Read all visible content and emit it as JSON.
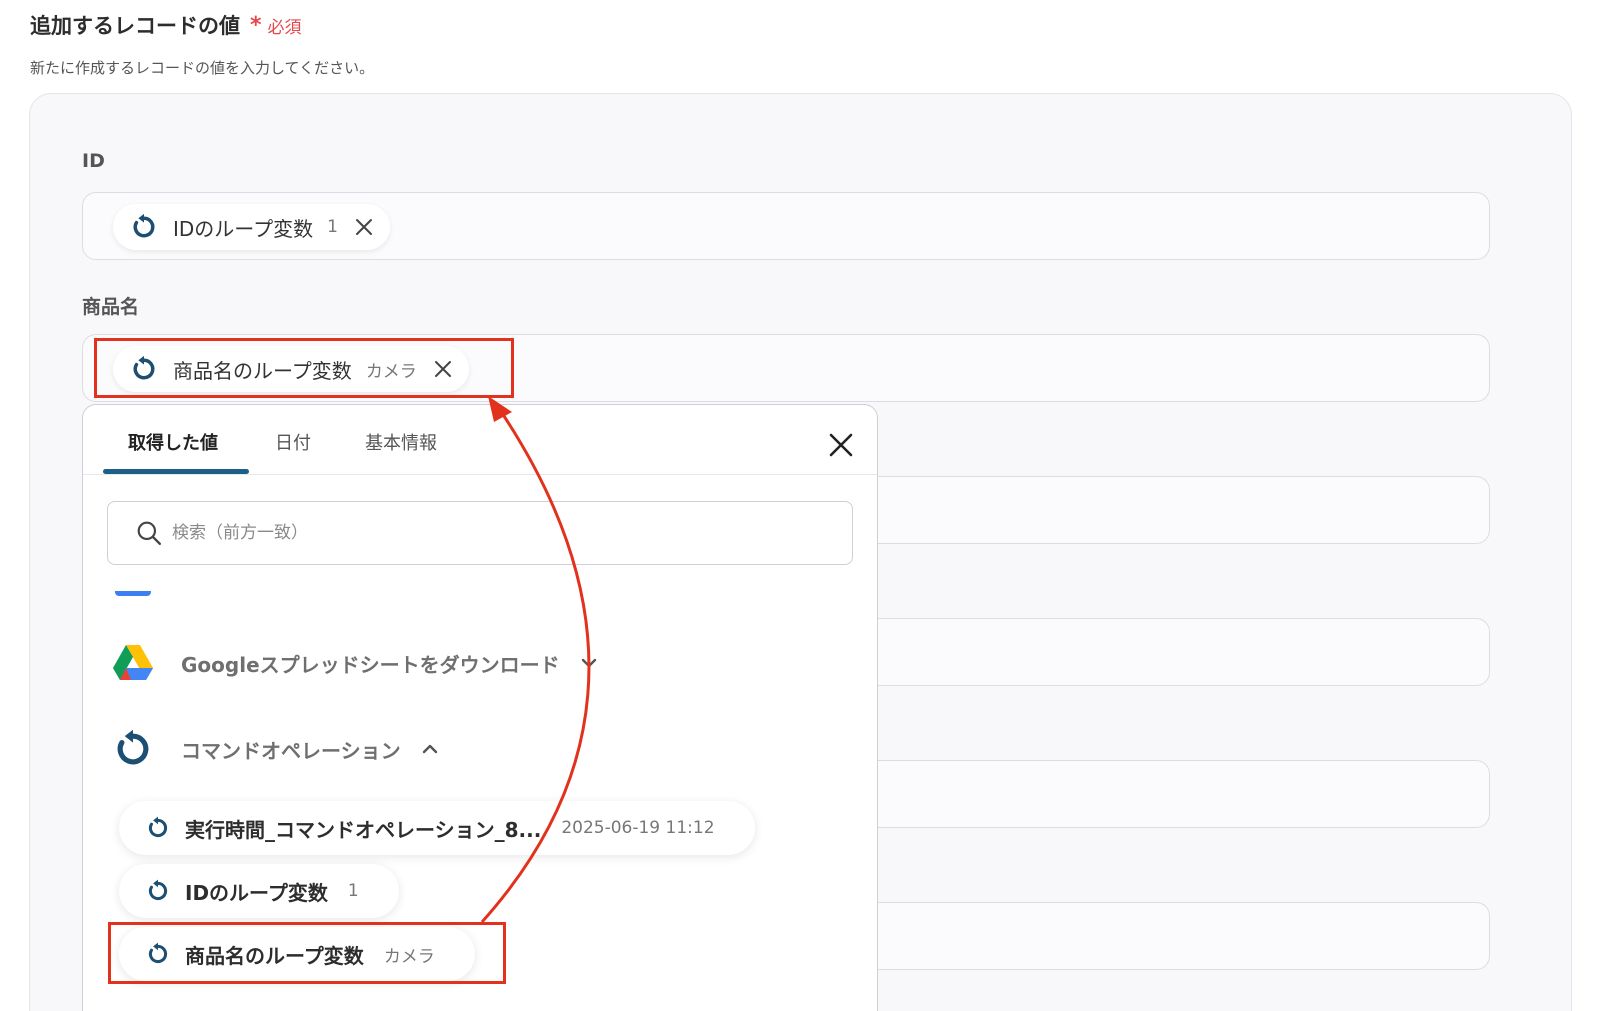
{
  "section": {
    "title": "追加するレコードの値",
    "required_mark": "*",
    "required_text": "必須",
    "description": "新たに作成するレコードの値を入力してください。"
  },
  "fields": [
    {
      "label": "ID",
      "chip": {
        "label": "IDのループ変数",
        "value": "1"
      }
    },
    {
      "label": "商品名",
      "chip": {
        "label": "商品名のループ変数",
        "value": "カメラ"
      }
    }
  ],
  "popup": {
    "tabs": [
      {
        "label": "取得した値",
        "active": true
      },
      {
        "label": "日付",
        "active": false
      },
      {
        "label": "基本情報",
        "active": false
      }
    ],
    "search_placeholder": "検索（前方一致）",
    "groups": [
      {
        "label": "Googleスプレッドシートをダウンロード",
        "icon": "google-drive-icon",
        "expanded": false
      },
      {
        "label": "コマンドオペレーション",
        "icon": "loop-icon",
        "expanded": true
      }
    ],
    "items": [
      {
        "label": "実行時間_コマンドオペレーション_8...",
        "value": "2025-06-19 11:12"
      },
      {
        "label": "IDのループ変数",
        "value": "1"
      },
      {
        "label": "商品名のループ変数",
        "value": "カメラ"
      }
    ]
  },
  "colors": {
    "accent": "#1d5f86",
    "highlight": "#e2321d",
    "required": "#e5484d"
  }
}
